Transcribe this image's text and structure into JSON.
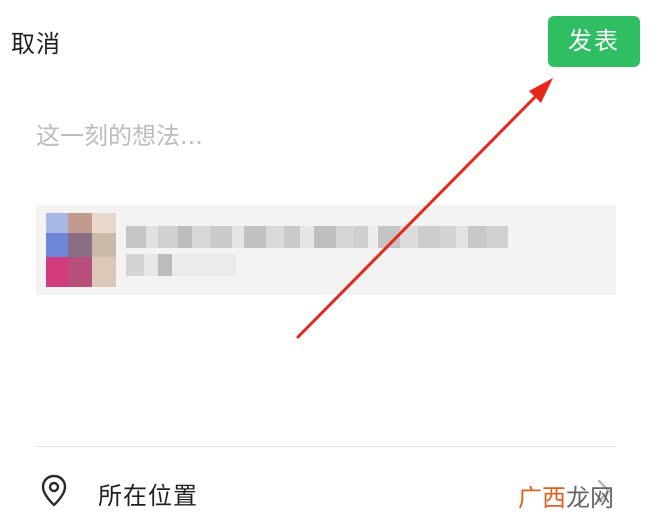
{
  "header": {
    "cancel_label": "取消",
    "post_label": "发表"
  },
  "composer": {
    "placeholder": "这一刻的想法..."
  },
  "location": {
    "label": "所在位置"
  },
  "watermark": {
    "part1": "广西",
    "part2": "龙网"
  },
  "colors": {
    "post_button": "#2fbf62",
    "annotation_arrow": "#e8271b"
  }
}
